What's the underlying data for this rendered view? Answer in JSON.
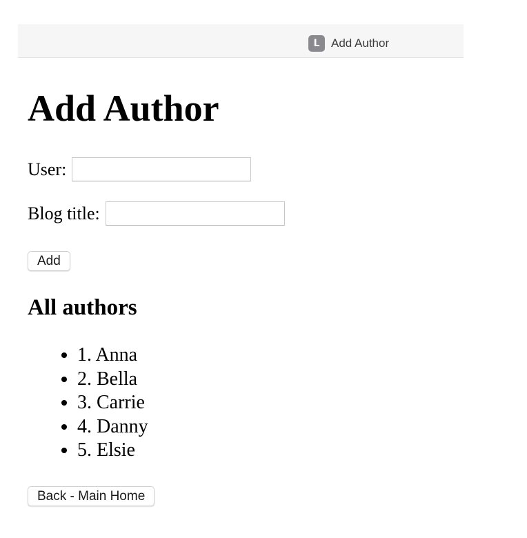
{
  "browser": {
    "tab_favicon_letter": "L",
    "tab_title": "Add Author"
  },
  "page": {
    "heading": "Add Author",
    "form": {
      "user_label": "User:",
      "user_value": "",
      "blog_title_label": "Blog title:",
      "blog_title_value": "",
      "add_button_label": "Add"
    },
    "authors_heading": "All authors",
    "authors": [
      "1. Anna",
      "2. Bella",
      "3. Carrie",
      "4. Danny",
      "5. Elsie"
    ],
    "back_button_label": "Back - Main Home"
  }
}
